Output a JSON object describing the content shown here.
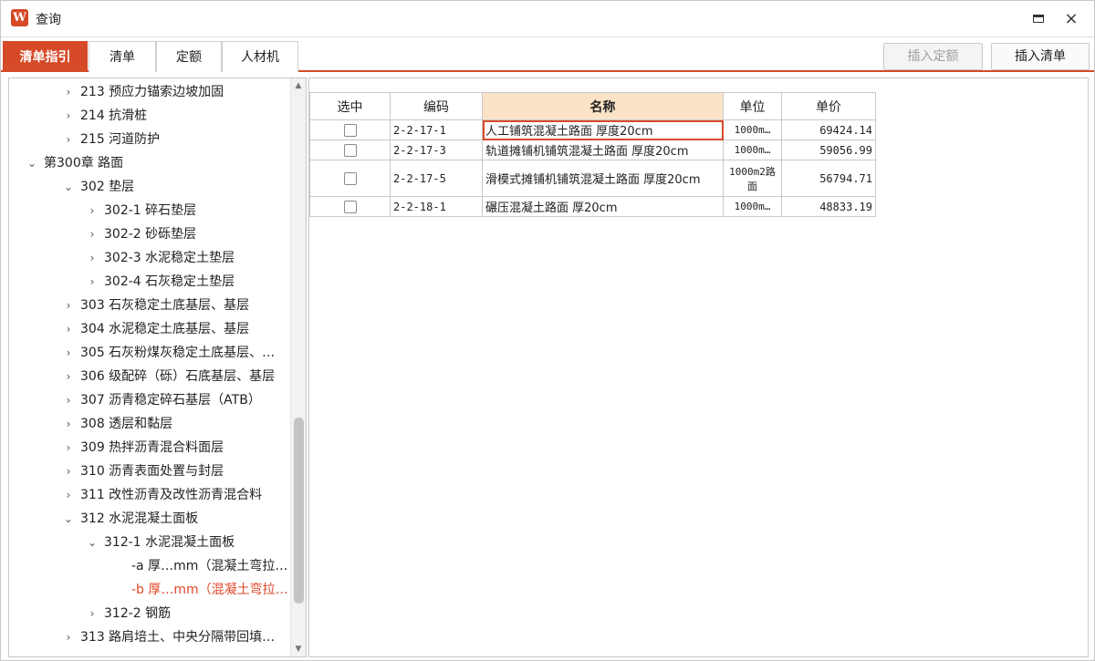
{
  "window": {
    "title": "查询",
    "app_icon_letter": "W",
    "maximize_icon": "maximize-icon",
    "close_icon": "×"
  },
  "tabs": [
    {
      "label": "清单指引",
      "active": true
    },
    {
      "label": "清单",
      "active": false
    },
    {
      "label": "定额",
      "active": false
    },
    {
      "label": "人材机",
      "active": false
    }
  ],
  "toolbar": {
    "insert_quota_label": "插入定额",
    "insert_list_label": "插入清单"
  },
  "tree": {
    "items": [
      {
        "chevron": "›",
        "label": "213 预应力锚索边坡加固"
      },
      {
        "chevron": "›",
        "label": "214 抗滑桩"
      },
      {
        "chevron": "›",
        "label": "215 河道防护"
      },
      {
        "chevron": "⌄",
        "label": "第300章 路面"
      },
      {
        "chevron": "⌄",
        "label": "302 垫层"
      },
      {
        "chevron": "›",
        "label": "302-1 碎石垫层"
      },
      {
        "chevron": "›",
        "label": "302-2 砂砾垫层"
      },
      {
        "chevron": "›",
        "label": "302-3 水泥稳定土垫层"
      },
      {
        "chevron": "›",
        "label": "302-4 石灰稳定土垫层"
      },
      {
        "chevron": "›",
        "label": "303 石灰稳定土底基层、基层"
      },
      {
        "chevron": "›",
        "label": "304 水泥稳定土底基层、基层"
      },
      {
        "chevron": "›",
        "label": "305 石灰粉煤灰稳定土底基层、…"
      },
      {
        "chevron": "›",
        "label": "306 级配碎（砾）石底基层、基层"
      },
      {
        "chevron": "›",
        "label": "307 沥青稳定碎石基层（ATB）"
      },
      {
        "chevron": "›",
        "label": "308 透层和黏层"
      },
      {
        "chevron": "›",
        "label": "309 热拌沥青混合料面层"
      },
      {
        "chevron": "›",
        "label": "310 沥青表面处置与封层"
      },
      {
        "chevron": "›",
        "label": "311 改性沥青及改性沥青混合料"
      },
      {
        "chevron": "⌄",
        "label": "312 水泥混凝土面板"
      },
      {
        "chevron": "⌄",
        "label": "312-1 水泥混凝土面板"
      },
      {
        "chevron": "",
        "label": "-a 厚…mm（混凝土弯拉…"
      },
      {
        "chevron": "",
        "label": "-b 厚…mm（混凝土弯拉…",
        "selected": true
      },
      {
        "chevron": "›",
        "label": "312-2 钢筋"
      },
      {
        "chevron": "›",
        "label": "313 路肩培土、中央分隔带回填…"
      }
    ],
    "scroll_up_icon": "▲",
    "scroll_down_icon": "▼"
  },
  "table": {
    "headers": [
      "选中",
      "编码",
      "名称",
      "单位",
      "单价"
    ],
    "rows": [
      {
        "checked": false,
        "code": "2-2-17-1",
        "name": "人工铺筑混凝土路面 厚度20cm",
        "unit": "1000m…",
        "price": "69424.14"
      },
      {
        "checked": false,
        "code": "2-2-17-3",
        "name": "轨道摊铺机铺筑混凝土路面 厚度20cm",
        "unit": "1000m…",
        "price": "59056.99"
      },
      {
        "checked": false,
        "code": "2-2-17-5",
        "name": "滑模式摊铺机铺筑混凝土路面 厚度20cm",
        "unit": "1000m2路面",
        "price": "56794.71"
      },
      {
        "checked": false,
        "code": "2-2-18-1",
        "name": "碾压混凝土路面 厚20cm",
        "unit": "1000m…",
        "price": "48833.19"
      }
    ]
  },
  "colors": {
    "accent": "#d64a28",
    "selected_text": "#e0472a",
    "sorted_header": "#fbe3c7"
  }
}
